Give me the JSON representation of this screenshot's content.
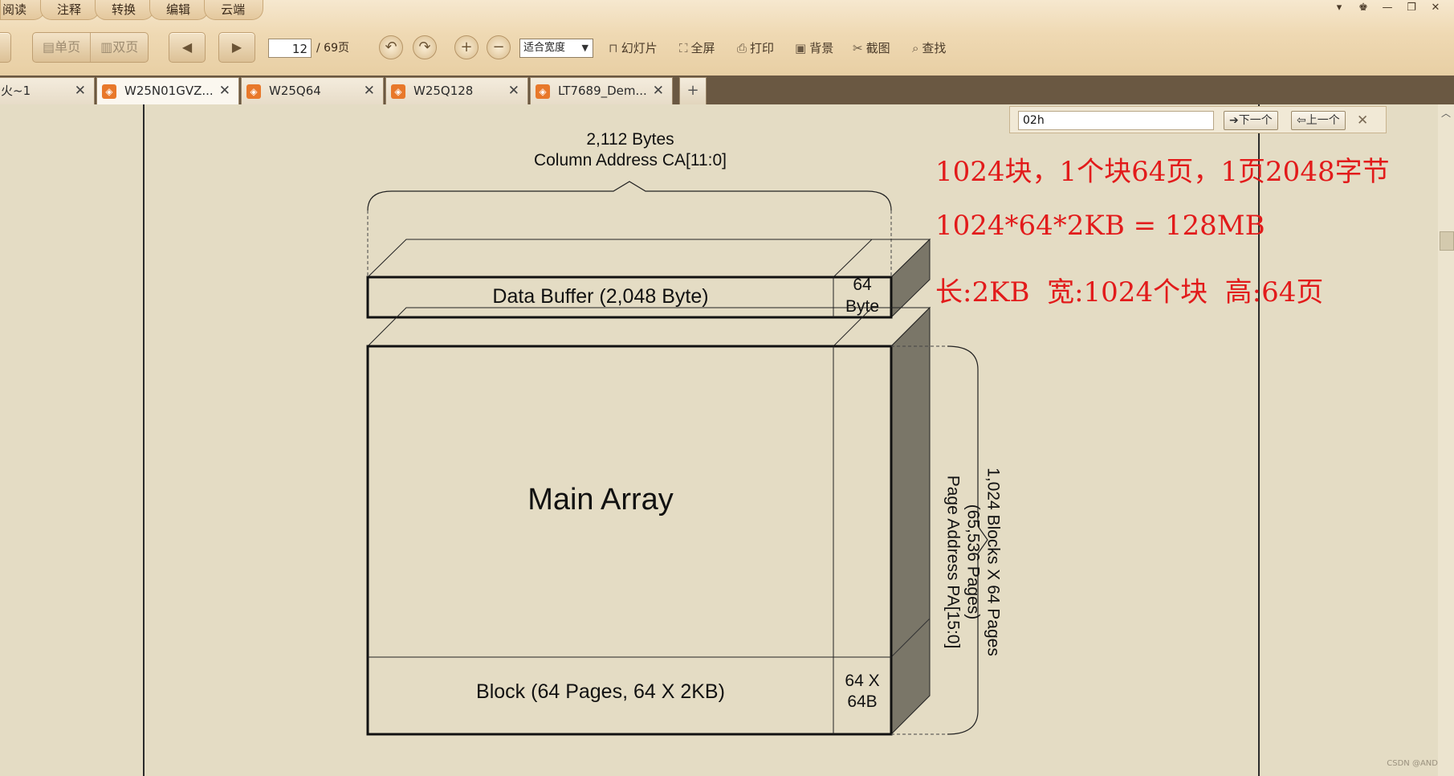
{
  "menu": {
    "tabs": [
      "阅读",
      "注释",
      "转换",
      "编辑",
      "云端"
    ]
  },
  "toolbar": {
    "single_page": "单页",
    "double_page": "双页",
    "page_current": "12",
    "page_total": "/ 69页",
    "zoom_mode": "适合宽度",
    "slideshow": "幻灯片",
    "fullscreen": "全屏",
    "print": "打印",
    "background": "背景",
    "screenshot": "截图",
    "search": "查找"
  },
  "tabs": [
    {
      "title": "火~1"
    },
    {
      "title": "W25N01GVZ..."
    },
    {
      "title": "W25Q64"
    },
    {
      "title": "W25Q128"
    },
    {
      "title": "LT7689_Dem..."
    }
  ],
  "find": {
    "query": "02h",
    "next": "下一个",
    "prev": "上一个"
  },
  "diagram": {
    "top_size": "2,112 Bytes",
    "column_address": "Column Address CA[11:0]",
    "data_buffer": "Data Buffer (2,048 Byte)",
    "spare_line1": "64",
    "spare_line2": "Byte",
    "main_array": "Main Array",
    "block": "Block (64 Pages, 64 X 2KB)",
    "block_spare_line1": "64 X",
    "block_spare_line2": "64B",
    "side_line1": "1,024 Blocks X 64 Pages",
    "side_line2": "(65,536 Pages)",
    "side_line3": "Page Address PA[15:0]"
  },
  "annotations": [
    "1024块，1个块64页，1页2048字节",
    "1024*64*2KB = 128MB",
    "长:2KB  宽:1024个块  高:64页"
  ],
  "watermark": "CSDN @AND",
  "colors": {
    "annotation": "#e21b1b",
    "toolbar": "#efd9b3",
    "page": "#e4dcc4",
    "tabbar": "#6a5842"
  }
}
